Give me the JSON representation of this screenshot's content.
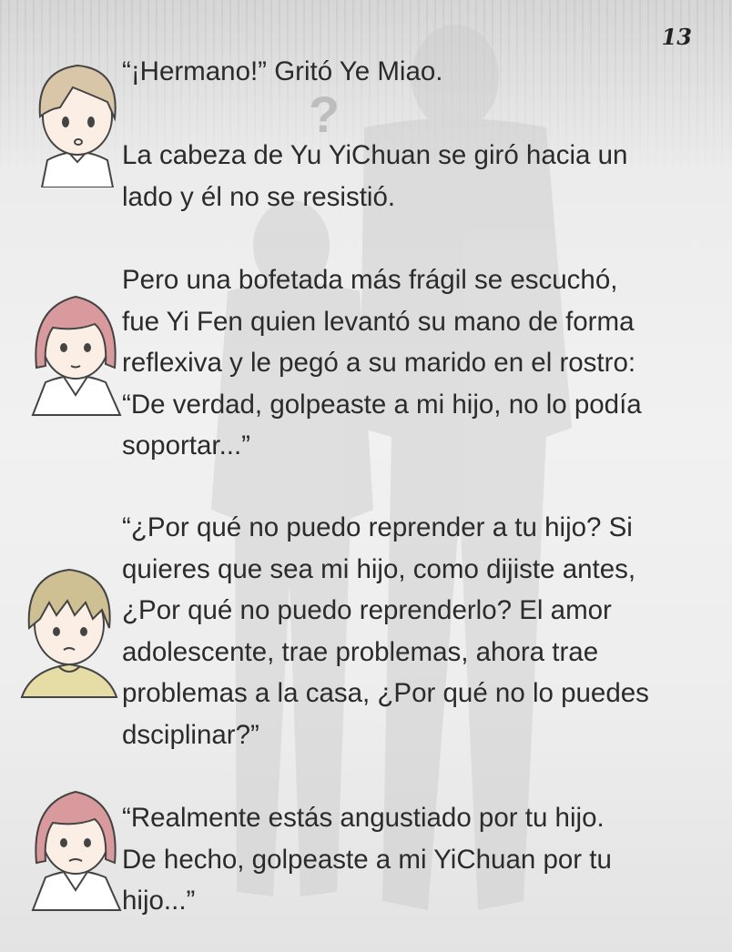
{
  "page": {
    "number": "13"
  },
  "decor": {
    "question_mark": "?"
  },
  "paragraphs": [
    {
      "speaker_icon": "boy-ye-miao-avatar-icon",
      "text": "“¡Hermano!” Gritó Ye Miao."
    },
    {
      "speaker_icon": "",
      "text": "La cabeza de Yu YiChuan se giró hacia un\nlado y él no se resistió."
    },
    {
      "speaker_icon": "woman-yi-fen-avatar-icon",
      "text": "Pero una bofetada más frágil se escuchó,\nfue Yi Fen quien levantó su mano de forma\nreflexiva y le pegó a su marido en el rostro:\n“De verdad, golpeaste a mi hijo, no lo podía\nsoportar...”"
    },
    {
      "speaker_icon": "man-avatar-icon",
      "text": "“¿Por qué no puedo reprender a tu hijo? Si\nquieres que sea mi hijo, como dijiste antes,\n¿Por qué no puedo reprenderlo? El amor\nadolescente, trae problemas, ahora trae\nproblemas a la casa, ¿Por qué no lo puedes\ndsciplinar?”"
    },
    {
      "speaker_icon": "woman-yi-fen-avatar-icon",
      "text": "“Realmente estás angustiado por tu hijo.\nDe hecho, golpeaste a mi YiChuan por tu\nhijo...”"
    }
  ],
  "colors": {
    "hair_light_brown": "#d9c6a8",
    "hair_pink": "#d99a9e",
    "hair_khaki": "#cfc093",
    "shirt_khaki": "#e6dca6",
    "text": "#2b2b2b"
  }
}
